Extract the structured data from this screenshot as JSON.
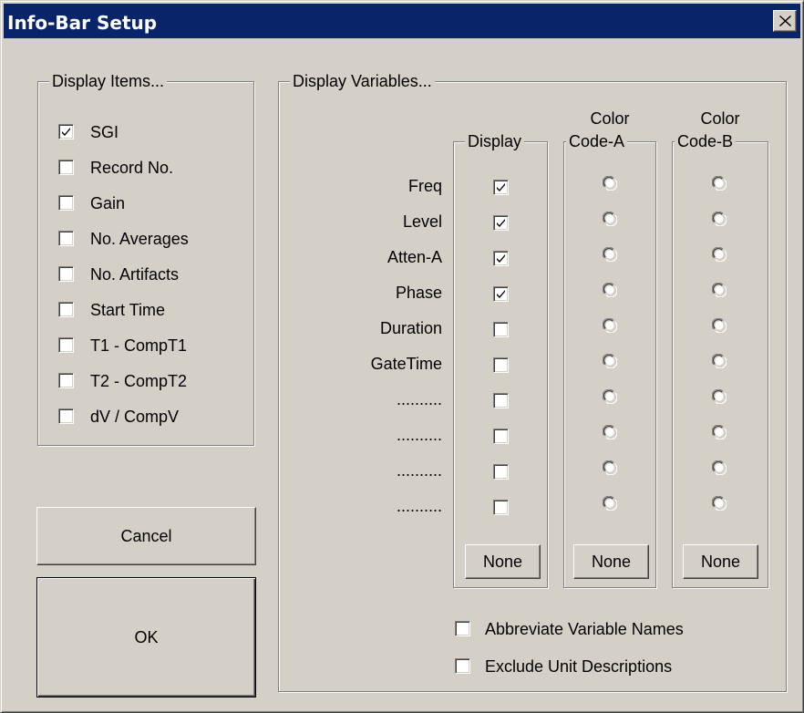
{
  "window": {
    "title": "Info-Bar Setup"
  },
  "display_items": {
    "title": "Display Items...",
    "items": [
      {
        "label": "SGI",
        "checked": true
      },
      {
        "label": "Record No.",
        "checked": false
      },
      {
        "label": "Gain",
        "checked": false
      },
      {
        "label": "No. Averages",
        "checked": false
      },
      {
        "label": "No. Artifacts",
        "checked": false
      },
      {
        "label": "Start Time",
        "checked": false
      },
      {
        "label": "T1 - CompT1",
        "checked": false
      },
      {
        "label": "T2 - CompT2",
        "checked": false
      },
      {
        "label": "dV / CompV",
        "checked": false
      }
    ]
  },
  "buttons": {
    "cancel": "Cancel",
    "ok": "OK"
  },
  "display_variables": {
    "title": "Display Variables...",
    "columns": {
      "display": "Display",
      "color_a_top": "Color",
      "color_a_bottom": "Code-A",
      "color_b_top": "Color",
      "color_b_bottom": "Code-B"
    },
    "variables": [
      {
        "name": "Freq",
        "display": true
      },
      {
        "name": "Level",
        "display": true
      },
      {
        "name": "Atten-A",
        "display": true
      },
      {
        "name": "Phase",
        "display": true
      },
      {
        "name": "Duration",
        "display": false
      },
      {
        "name": "GateTime",
        "display": false
      },
      {
        "name": "..........",
        "display": false
      },
      {
        "name": "..........",
        "display": false
      },
      {
        "name": "..........",
        "display": false
      },
      {
        "name": "..........",
        "display": false
      }
    ],
    "none_label": "None",
    "options": [
      {
        "label": "Abbreviate Variable Names",
        "checked": false
      },
      {
        "label": "Exclude Unit Descriptions",
        "checked": false
      }
    ]
  }
}
